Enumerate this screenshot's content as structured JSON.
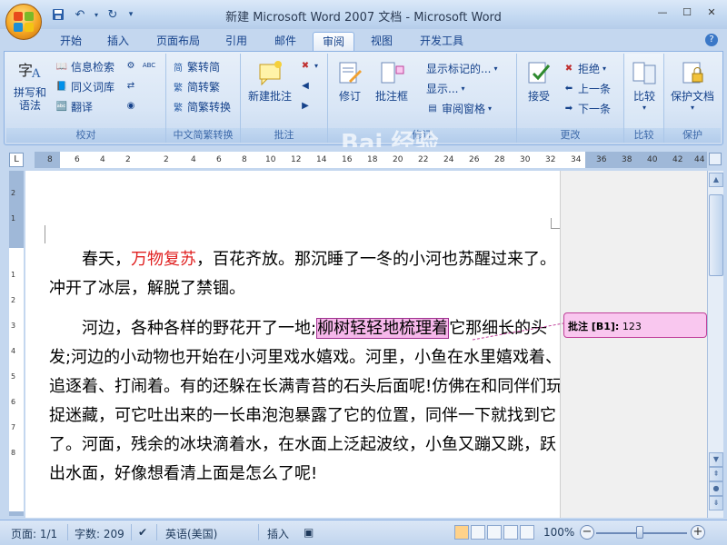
{
  "window": {
    "title": "新建 Microsoft Word 2007 文档 - Microsoft Word"
  },
  "tabs": [
    "开始",
    "插入",
    "页面布局",
    "引用",
    "邮件",
    "审阅",
    "视图",
    "开发工具"
  ],
  "active_tab": "审阅",
  "ribbon": {
    "proofing": {
      "label": "校对",
      "spelling": "拼写和\n语法",
      "research": "信息检索",
      "thesaurus": "同义词库",
      "translate": "翻译"
    },
    "chinese_conversion": {
      "label": "中文简繁转换",
      "to_simplified": "繁转简",
      "to_traditional": "简转繁",
      "convert": "简繁转换"
    },
    "comments": {
      "label": "批注",
      "new_comment": "新建批注"
    },
    "tracking": {
      "label": "修订",
      "track_changes": "修订",
      "show_markup": "显示标记的...",
      "balloons": "批注框",
      "display": "显示...",
      "reviewing_pane": "审阅窗格"
    },
    "changes": {
      "label": "更改",
      "accept": "接受",
      "reject": "拒绝",
      "previous": "上一条",
      "next": "下一条"
    },
    "compare": {
      "label": "比较",
      "compare": "比较"
    },
    "protect": {
      "label": "保护",
      "protect_document": "保护文档"
    }
  },
  "ruler": {
    "ticks": [
      "8",
      "6",
      "4",
      "2",
      "2",
      "4",
      "6",
      "8",
      "10",
      "12",
      "14",
      "16",
      "18",
      "20",
      "22",
      "24",
      "26",
      "28",
      "30",
      "32",
      "34",
      "36",
      "38",
      "40",
      "42",
      "44"
    ],
    "vticks": [
      "2",
      "1",
      "1",
      "2",
      "3",
      "4",
      "5",
      "6",
      "7",
      "8"
    ]
  },
  "document": {
    "para1": {
      "before": "春天，",
      "red": "万物复苏",
      "after": "，百花齐放。那沉睡了一冬的小河也苏醒过来了。冲开了冰层，解脱了禁锢。"
    },
    "para2": {
      "before": "河边，各种各样的野花开了一地;",
      "highlight": "柳树轻轻地梳理着",
      "after": "它那细长的头发;河边的小动物也开始在小河里戏水嬉戏。河里，小鱼在水里嬉戏着、追逐着、打闹着。有的还躲在长满青苔的石头后面呢!仿佛在和同伴们玩捉迷藏，可它吐出来的一长串泡泡暴露了它的位置，同伴一下就找到它了。河面，残余的冰块滴着水，在水面上泛起波纹，小鱼又蹦又跳，跃出水面，好像想看清上面是怎么了呢!"
    }
  },
  "comment": {
    "label": "批注 [B1]:",
    "text": "123"
  },
  "status": {
    "page": "页面: 1/1",
    "words": "字数: 209",
    "language": "英语(美国)",
    "insert_mode": "插入",
    "zoom": "100%"
  },
  "watermark": {
    "line1": "Bai 经验",
    "line2": "jingyan.baidu.com"
  },
  "colors": {
    "ribbon_bg": "#dbe7f6",
    "highlight": "#f6b7ea",
    "red_text": "#e02020",
    "accent": "#15428b"
  }
}
